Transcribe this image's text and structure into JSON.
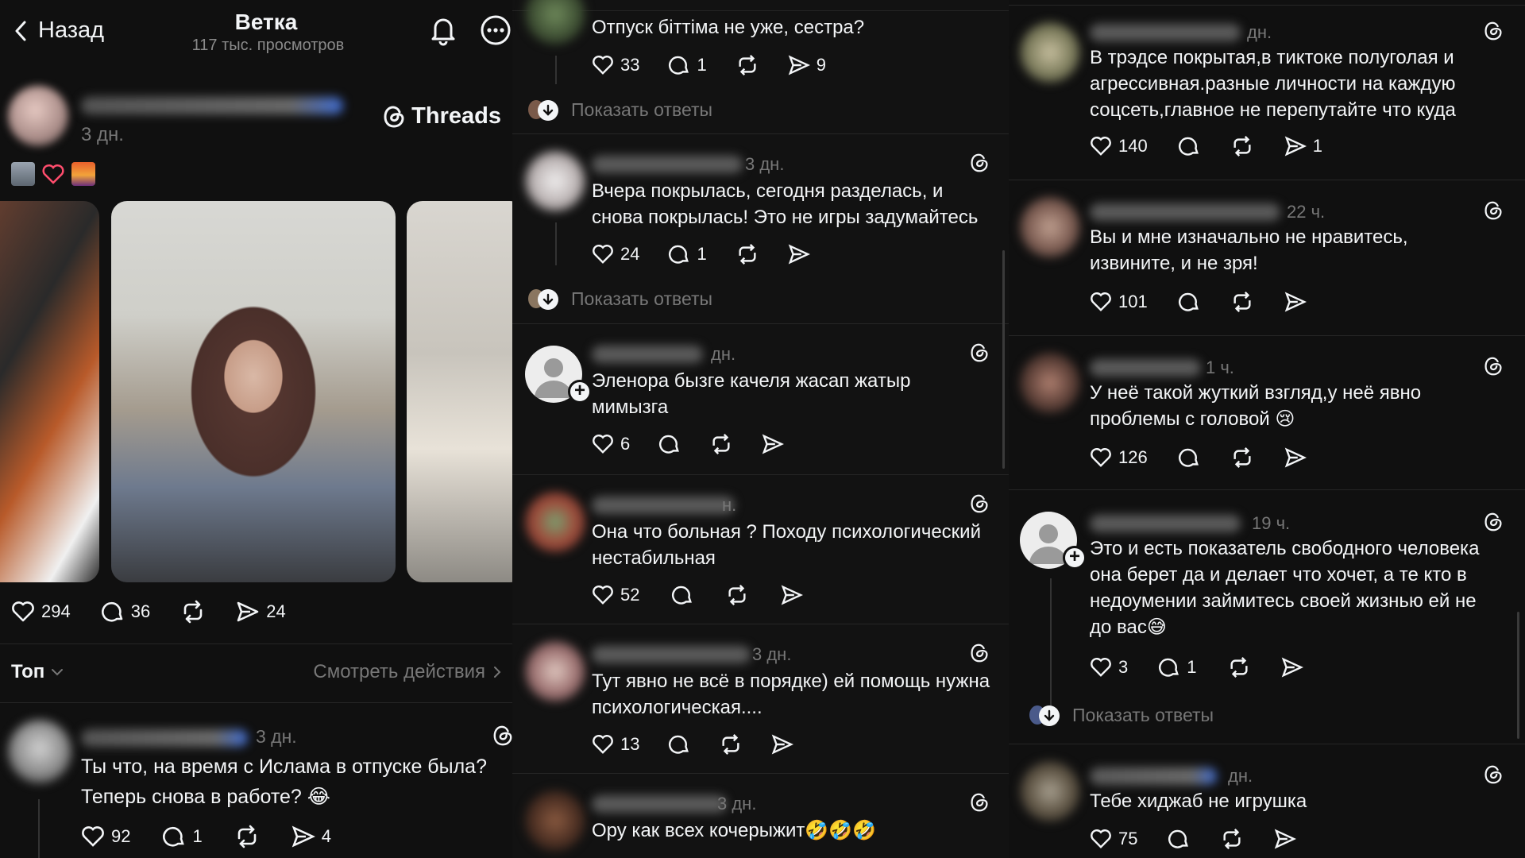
{
  "panel1": {
    "back_label": "Назад",
    "title": "Ветка",
    "subtitle": "117 тыс. просмотров",
    "author_time": "3 дн.",
    "brand": "Threads",
    "post_actions": {
      "likes": "294",
      "comments": "36",
      "shares": "24"
    },
    "sort_label": "Топ",
    "view_activity": "Смотреть действия",
    "comment": {
      "time": "3 дн.",
      "text_line1": "Ты что, на время с Ислама в отпуске была?",
      "text_line2": "Теперь снова в работе? 😂",
      "likes": "92",
      "comments": "1",
      "shares": "4"
    }
  },
  "panel2": {
    "top_text": "Отпуск біттіма не уже, сестра?",
    "top_actions": {
      "likes": "33",
      "comments": "1",
      "shares": "9"
    },
    "show_replies": "Показать ответы",
    "comments": [
      {
        "time": "3 дн.",
        "line1": "Вчера покрылась, сегодня разделась, и",
        "line2": "снова покрылась! Это не игры задумайтесь",
        "likes": "24",
        "comments": "1"
      },
      {
        "time": "дн.",
        "line1": "Эленора бызге качеля жасап жатыр",
        "line2": "мимызга",
        "likes": "6"
      },
      {
        "time": "н.",
        "line1": "Она что больная ? Походу психологический",
        "line2": "нестабильная",
        "likes": "52"
      },
      {
        "time": "3 дн.",
        "line1": "Тут явно не всё в порядке) ей помощь нужна",
        "line2": "психологическая....",
        "likes": "13"
      },
      {
        "time": "3 дн.",
        "line1": "Ору как всех кочерыжит🤣🤣🤣",
        "line2": ""
      }
    ]
  },
  "panel3": {
    "show_replies": "Показать ответы",
    "comments": [
      {
        "time": "дн.",
        "line1": "В трэдсе покрытая,в тиктоке полуголая и",
        "line2": "агрессивная.разные личности на каждую",
        "line3": "соцсеть,главное не перепутайте что куда",
        "line4": "",
        "likes": "140",
        "comments": "",
        "shares": "1"
      },
      {
        "time": "22 ч.",
        "line1": "Вы и мне изначально не нравитесь,",
        "line2": "извините, и не зря!",
        "line3": "",
        "line4": "",
        "likes": "101",
        "comments": "",
        "shares": ""
      },
      {
        "time": "1 ч.",
        "line1": "У неё такой жуткий взгляд,у неё явно",
        "line2": "проблемы с головой 😢",
        "line3": "",
        "line4": "",
        "likes": "126",
        "comments": "",
        "shares": ""
      },
      {
        "time": "19 ч.",
        "line1": "Это и есть показатель свободного человека",
        "line2": "она берет да и делает что хочет, а те кто в",
        "line3": "недоумении займитесь своей жизнью ей не",
        "line4": "до вас😅",
        "likes": "3",
        "comments": "1",
        "shares": ""
      },
      {
        "time": "дн.",
        "line1": "Тебе хиджаб не игрушка",
        "line2": "",
        "line3": "",
        "line4": "",
        "likes": "75",
        "comments": "",
        "shares": ""
      }
    ]
  }
}
